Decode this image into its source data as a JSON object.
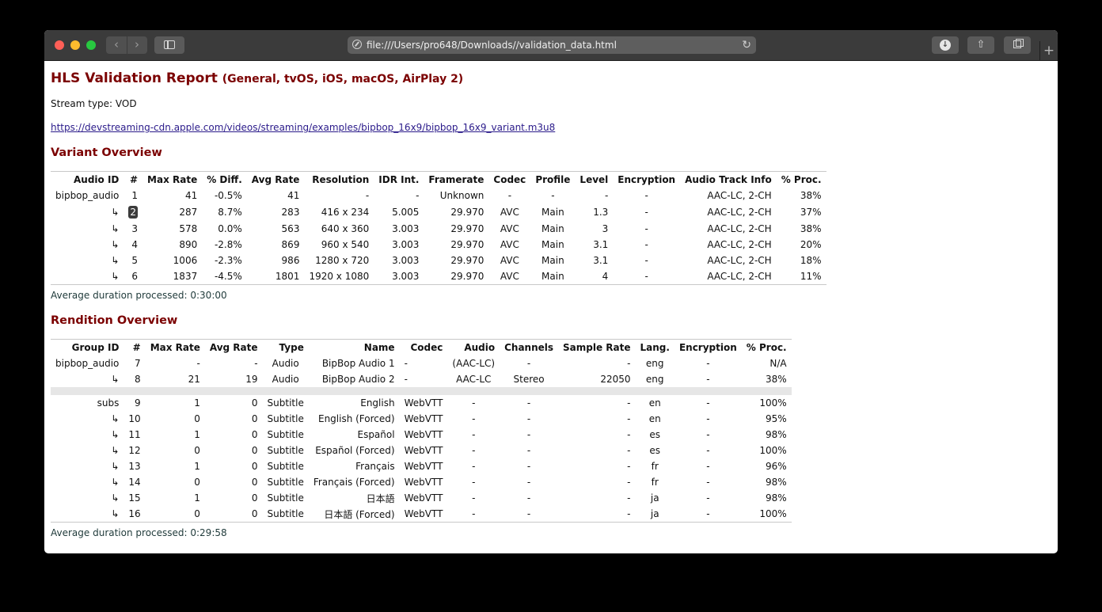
{
  "browser": {
    "url": "file:///Users/pro648/Downloads//validation_data.html",
    "back_glyph": "‹",
    "forward_glyph": "›",
    "reload_glyph": "↻",
    "download_glyph": "↓",
    "share_glyph": "⇧",
    "new_tab_glyph": "+"
  },
  "report": {
    "title": "HLS Validation Report",
    "subtitle": "(General, tvOS, iOS, macOS, AirPlay 2)",
    "stream_type": "Stream type: VOD",
    "url": "https://devstreaming-cdn.apple.com/videos/streaming/examples/bipbop_16x9/bipbop_16x9_variant.m3u8"
  },
  "variant": {
    "heading": "Variant Overview",
    "columns": [
      "Audio ID",
      "#",
      "Max Rate",
      "% Diff.",
      "Avg Rate",
      "Resolution",
      "IDR Int.",
      "Framerate",
      "Codec",
      "Profile",
      "Level",
      "Encryption",
      "Audio Track Info",
      "% Proc."
    ],
    "rows": [
      [
        "bipbop_audio",
        "1",
        "41",
        "-0.5%",
        "41",
        "-",
        "-",
        "Unknown",
        "-",
        "-",
        "-",
        "-",
        "AAC-LC, 2-CH",
        "38%"
      ],
      [
        "↳",
        "2",
        "287",
        "8.7%",
        "283",
        "416 x 234",
        "5.005",
        "29.970",
        "AVC",
        "Main",
        "1.3",
        "-",
        "AAC-LC, 2-CH",
        "37%"
      ],
      [
        "↳",
        "3",
        "578",
        "0.0%",
        "563",
        "640 x 360",
        "3.003",
        "29.970",
        "AVC",
        "Main",
        "3",
        "-",
        "AAC-LC, 2-CH",
        "38%"
      ],
      [
        "↳",
        "4",
        "890",
        "-2.8%",
        "869",
        "960 x 540",
        "3.003",
        "29.970",
        "AVC",
        "Main",
        "3.1",
        "-",
        "AAC-LC, 2-CH",
        "20%"
      ],
      [
        "↳",
        "5",
        "1006",
        "-2.3%",
        "986",
        "1280 x 720",
        "3.003",
        "29.970",
        "AVC",
        "Main",
        "3.1",
        "-",
        "AAC-LC, 2-CH",
        "18%"
      ],
      [
        "↳",
        "6",
        "1837",
        "-4.5%",
        "1801",
        "1920 x 1080",
        "3.003",
        "29.970",
        "AVC",
        "Main",
        "4",
        "-",
        "AAC-LC, 2-CH",
        "11%"
      ]
    ],
    "avg_duration": "Average duration processed: 0:30:00"
  },
  "rendition": {
    "heading": "Rendition Overview",
    "columns": [
      "Group ID",
      "#",
      "Max Rate",
      "Avg Rate",
      "Type",
      "Name",
      "Codec",
      "Audio",
      "Channels",
      "Sample Rate",
      "Lang.",
      "Encryption",
      "% Proc."
    ],
    "rows_audio": [
      [
        "bipbop_audio",
        "7",
        "-",
        "-",
        "Audio",
        "BipBop Audio 1",
        "-",
        "(AAC-LC)",
        "-",
        "-",
        "eng",
        "-",
        "N/A"
      ],
      [
        "↳",
        "8",
        "21",
        "19",
        "Audio",
        "BipBop Audio 2",
        "-",
        "AAC-LC",
        "Stereo",
        "22050",
        "eng",
        "-",
        "38%"
      ]
    ],
    "rows_subs": [
      [
        "subs",
        "9",
        "1",
        "0",
        "Subtitle",
        "English",
        "WebVTT",
        "-",
        "-",
        "-",
        "en",
        "-",
        "100%"
      ],
      [
        "↳",
        "10",
        "0",
        "0",
        "Subtitle",
        "English (Forced)",
        "WebVTT",
        "-",
        "-",
        "-",
        "en",
        "-",
        "95%"
      ],
      [
        "↳",
        "11",
        "1",
        "0",
        "Subtitle",
        "Español",
        "WebVTT",
        "-",
        "-",
        "-",
        "es",
        "-",
        "98%"
      ],
      [
        "↳",
        "12",
        "0",
        "0",
        "Subtitle",
        "Español (Forced)",
        "WebVTT",
        "-",
        "-",
        "-",
        "es",
        "-",
        "100%"
      ],
      [
        "↳",
        "13",
        "1",
        "0",
        "Subtitle",
        "Français",
        "WebVTT",
        "-",
        "-",
        "-",
        "fr",
        "-",
        "96%"
      ],
      [
        "↳",
        "14",
        "0",
        "0",
        "Subtitle",
        "Français (Forced)",
        "WebVTT",
        "-",
        "-",
        "-",
        "fr",
        "-",
        "98%"
      ],
      [
        "↳",
        "15",
        "1",
        "0",
        "Subtitle",
        "日本語",
        "WebVTT",
        "-",
        "-",
        "-",
        "ja",
        "-",
        "98%"
      ],
      [
        "↳",
        "16",
        "0",
        "0",
        "Subtitle",
        "日本語 (Forced)",
        "WebVTT",
        "-",
        "-",
        "-",
        "ja",
        "-",
        "100%"
      ]
    ],
    "avg_duration": "Average duration processed: 0:29:58"
  }
}
